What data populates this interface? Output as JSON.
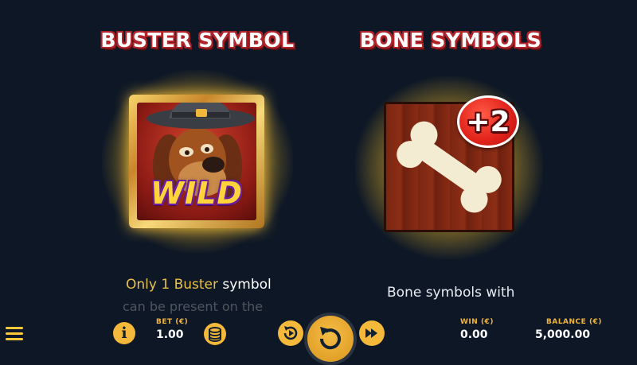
{
  "headings": {
    "buster": "BUSTER SYMBOL",
    "bone": "BONE SYMBOLS"
  },
  "symbols": {
    "wild_text": "WILD",
    "bone_badge": "+2",
    "wild_icon": "dog-cowboy-icon",
    "bone_icon": "bone-icon"
  },
  "descriptions": {
    "buster_line1_prefix": "Only 1 Buster",
    "buster_line1_suffix": "symbol",
    "buster_line2": "can be present on the",
    "bone_line1": "Bone symbols with"
  },
  "bottom_bar": {
    "bet_label": "BET (€)",
    "bet_value": "1.00",
    "win_label": "WIN (€)",
    "win_value": "0.00",
    "balance_label": "BALANCE (€)",
    "balance_value": "5,000.00",
    "info_glyph": "i",
    "icons": [
      "menu-icon",
      "info-icon",
      "coin-stack-icon",
      "autoplay-icon",
      "spin-icon",
      "fast-forward-icon"
    ]
  },
  "colors": {
    "background": "#0d1726",
    "accent_gold": "#f4b83a",
    "heading_outline": "#b0242a",
    "badge_red": "#e3241c"
  }
}
